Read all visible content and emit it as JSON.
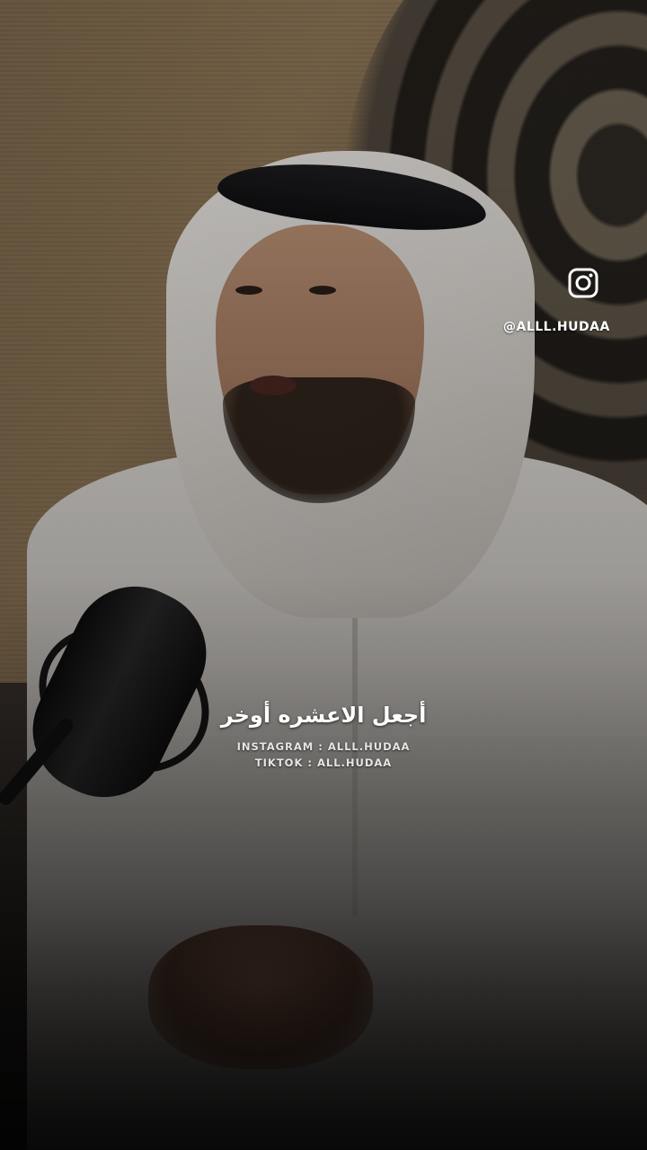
{
  "video": {
    "caption": "أجعل الاعشره أوخر",
    "credit_instagram": "INSTAGRAM : ALLL.HUDAA",
    "credit_tiktok": "TIKTOK : ALL.HUDAA"
  },
  "watermark": {
    "icon": "instagram-icon",
    "handle": "@ALLL.HUDAA"
  },
  "colors": {
    "overlay_text": "#ffffff",
    "background_dark": "#141210"
  }
}
